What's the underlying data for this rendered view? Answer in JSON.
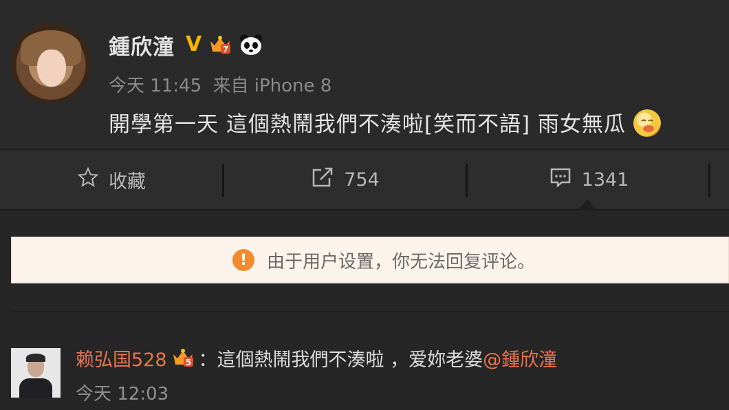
{
  "post": {
    "username": "鍾欣潼",
    "verified_badge": "V",
    "time": "今天 11:45",
    "source": "来自 iPhone 8",
    "content": "開學第一天 這個熱鬧我們不湊啦[笑而不語] 雨女無瓜",
    "icons": [
      "avatar",
      "verified-v-icon",
      "vip-crown-icon",
      "panda-icon",
      "emoji-icon"
    ]
  },
  "actions": {
    "favorite_label": "收藏",
    "repost_count": "754",
    "comment_count": "1341"
  },
  "notice": {
    "text": "由于用户设置，你无法回复评论。"
  },
  "comment": {
    "username": "赖弘国528",
    "separator": "：",
    "text": "這個熱鬧我們不湊啦 ，爱妳老婆",
    "mention": "@鍾欣潼",
    "time": "今天 12:03"
  },
  "colors": {
    "background": "#262626",
    "accent_username": "#eb7350",
    "verified": "#f7b500",
    "notice_bg": "#fcf3ea",
    "warn": "#f28a30"
  }
}
